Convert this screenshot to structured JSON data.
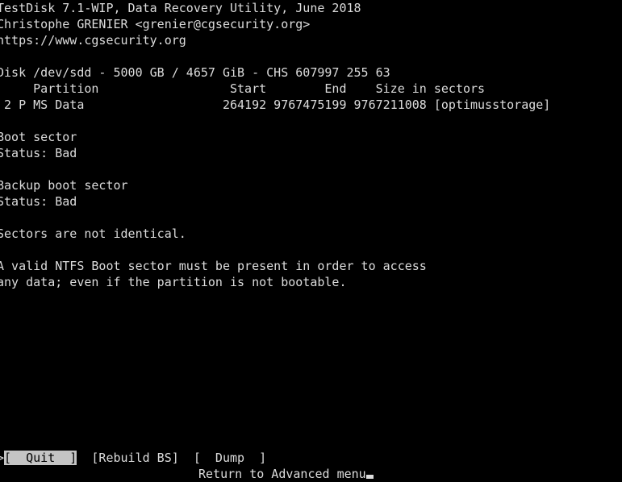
{
  "terminal": {
    "app_title": "TestDisk 7.1-WIP, Data Recovery Utility, June 2018",
    "author_line": "Christophe GRENIER <grenier@cgsecurity.org>",
    "website": "https://www.cgsecurity.org",
    "foreground_color": "#dcdcdc",
    "background_color": "#000000",
    "highlight_background_color": "#c4c4c4",
    "highlight_foreground_color": "#000000"
  },
  "disk": {
    "line": "Disk /dev/sdd - 5000 GB / 4657 GiB - CHS 607997 255 63",
    "device": "/dev/sdd",
    "size_gb": "5000 GB",
    "size_gib": "4657 GiB",
    "chs": "CHS 607997 255 63"
  },
  "partition_table": {
    "header": "     Partition                  Start        End    Size in sectors",
    "columns": [
      "Partition",
      "Start",
      "End",
      "Size in sectors"
    ],
    "rows": [
      {
        "line": " 2 P MS Data                   264192 9767475199 9767211008 [optimusstorage]",
        "index": "2",
        "status": "P",
        "type": "MS Data",
        "start": "264192",
        "end": "9767475199",
        "size_in_sectors": "9767211008",
        "label": "[optimusstorage]"
      }
    ]
  },
  "boot_sector": {
    "title": "Boot sector",
    "status_line": "Status: Bad",
    "status_value": "Bad"
  },
  "backup_boot_sector": {
    "title": "Backup boot sector",
    "status_line": "Status: Bad",
    "status_value": "Bad"
  },
  "comparison": {
    "line": "Sectors are not identical."
  },
  "warning": {
    "line1": "A valid NTFS Boot sector must be present in order to access",
    "line2": "any data; even if the partition is not bootable."
  },
  "menu": {
    "cursor_marker": ">",
    "items": [
      {
        "label": "[  Quit  ]",
        "selected": true
      },
      {
        "label": "[Rebuild BS]",
        "selected": false
      },
      {
        "label": "[  Dump  ]",
        "selected": false
      }
    ],
    "gap1": "  ",
    "gap2": "  ",
    "hint": "Return to Advanced menu"
  }
}
